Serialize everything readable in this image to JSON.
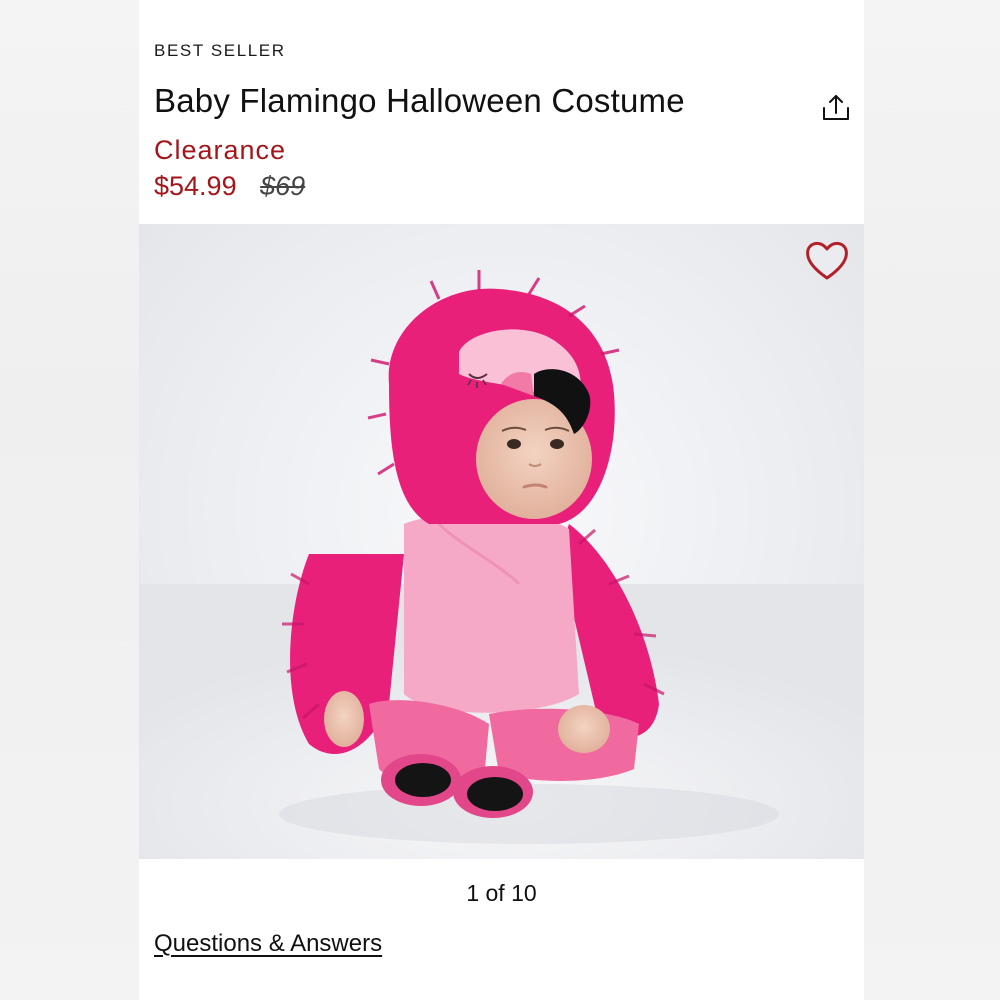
{
  "product": {
    "badge": "BEST SELLER",
    "title": "Baby Flamingo Halloween Costume",
    "status_label": "Clearance",
    "price_sale": "$54.99",
    "price_original": "$69"
  },
  "gallery": {
    "pager": "1 of 10",
    "image_subject": "baby in pink flamingo costume"
  },
  "links": {
    "questions": "Questions & Answers"
  },
  "icons": {
    "share": "share-icon",
    "favorite": "heart-icon"
  },
  "colors": {
    "accent": "#a4161a",
    "costume_pink": "#e8207a",
    "costume_light_pink": "#f6a9c6"
  }
}
